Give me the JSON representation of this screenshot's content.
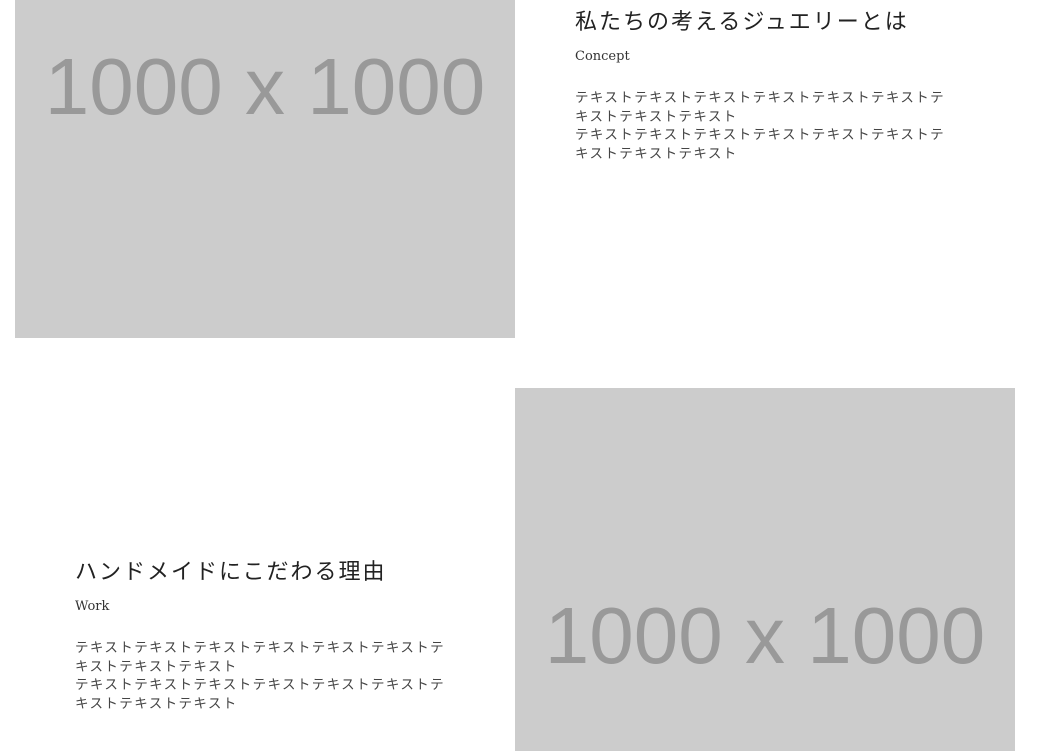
{
  "images": [
    {
      "label": "1000 x 1000"
    },
    {
      "label": "1000 x 1000"
    }
  ],
  "sections": [
    {
      "heading": "私たちの考えるジュエリーとは",
      "subtitle": "Concept",
      "paragraphs": [
        "テキストテキストテキストテキストテキストテキストテキストテキストテキスト",
        "テキストテキストテキストテキストテキストテキストテキストテキストテキスト"
      ]
    },
    {
      "heading": "ハンドメイドにこだわる理由",
      "subtitle": "Work",
      "paragraphs": [
        "テキストテキストテキストテキストテキストテキストテキストテキストテキスト",
        "テキストテキストテキストテキストテキストテキストテキストテキストテキスト"
      ]
    }
  ],
  "colors": {
    "placeholder_bg": "#cccccc",
    "placeholder_text": "#999999",
    "background": "#ffffff"
  }
}
